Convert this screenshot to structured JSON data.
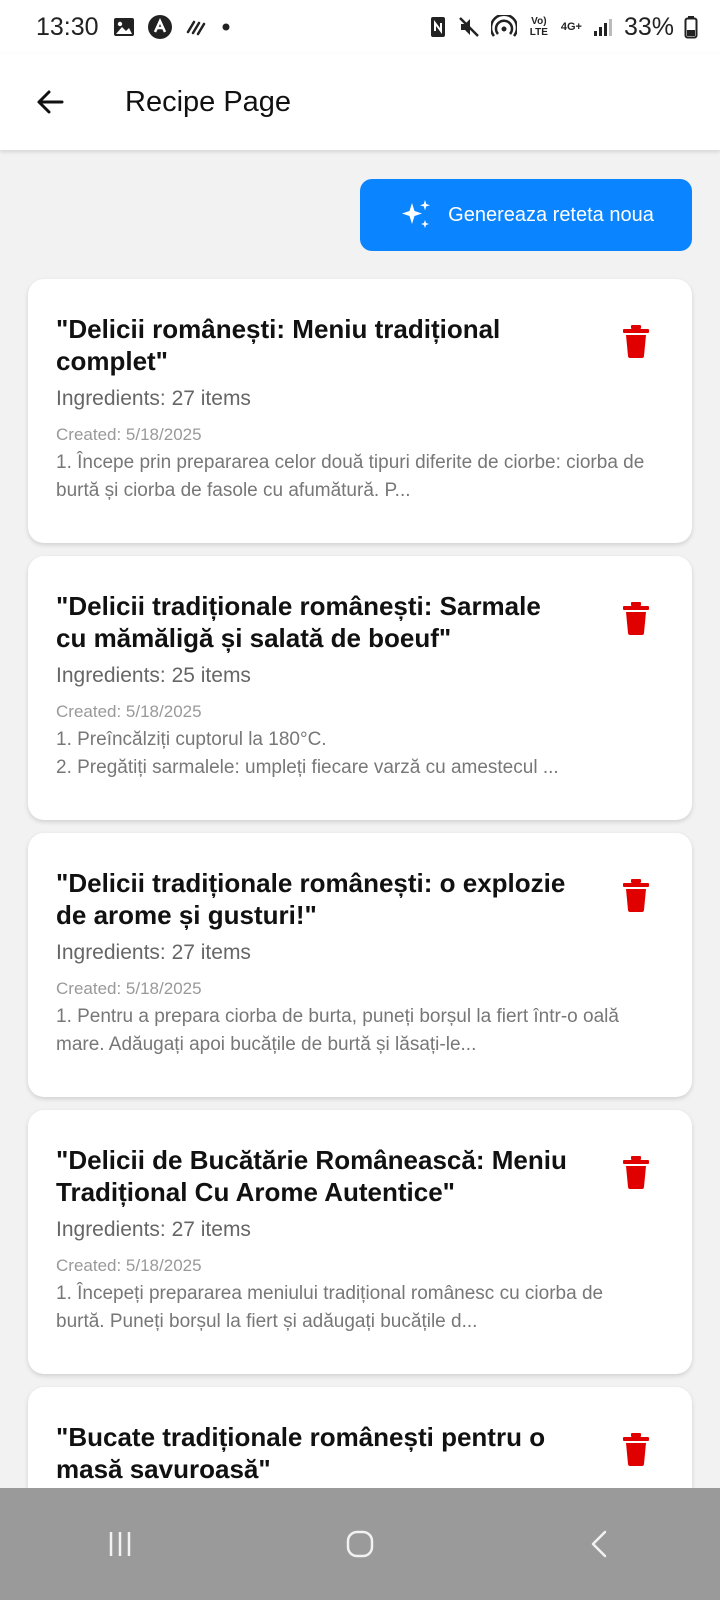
{
  "status_bar": {
    "time": "13:30",
    "battery": "33%",
    "left_icons": [
      "gallery-icon",
      "app-icon",
      "signal-wave-icon",
      "dot-icon"
    ],
    "right_icons": [
      "nfc-icon",
      "mute-icon",
      "hotspot-icon",
      "volte-icon",
      "4g-icon",
      "cell-signal-icon",
      "battery-icon"
    ],
    "volte_label": "Vo) LTE",
    "network_label": "4G+"
  },
  "app_bar": {
    "title": "Recipe Page",
    "back_icon": "arrow-left-icon"
  },
  "generate_button": {
    "label": "Genereaza reteta noua",
    "icon": "sparkles-icon",
    "color": "#0a84ff"
  },
  "recipes": [
    {
      "title": "\"Delicii românești: Meniu tradițional complet\"",
      "ingredients": "Ingredients: 27 items",
      "created": "Created: 5/18/2025",
      "description": "1. Începe prin prepararea celor două tipuri diferite de ciorbe: ciorba de burtă și ciorba de fasole cu afumătură. P..."
    },
    {
      "title": "\"Delicii tradiționale românești: Sarmale cu mămăligă și salată de boeuf\"",
      "ingredients": "Ingredients: 25 items",
      "created": "Created: 5/18/2025",
      "description": "1. Preîncălziți cuptorul la 180°C.\n2. Pregătiți sarmalele: umpleți fiecare varză cu amestecul ..."
    },
    {
      "title": "\"Delicii tradiționale românești: o explozie de arome și gusturi!\"",
      "ingredients": "Ingredients: 27 items",
      "created": "Created: 5/18/2025",
      "description": "1. Pentru a prepara ciorba de burta, puneți borșul la fiert într-o oală mare. Adăugați apoi bucățile de burtă și lăsați-le..."
    },
    {
      "title": "\"Delicii de Bucătărie Românească: Meniu Tradițional Cu Arome Autentice\"",
      "ingredients": "Ingredients: 27 items",
      "created": "Created: 5/18/2025",
      "description": "1. Începeți prepararea meniului tradițional românesc cu ciorba de burtă. Puneți borșul la fiert și adăugați bucățile d..."
    },
    {
      "title": "\"Bucate tradiționale românești pentru o masă savuroasă\"",
      "ingredients": "",
      "created": "",
      "description": ""
    }
  ],
  "delete_icon_color": "#e00000",
  "nav_bar": {
    "items": [
      "recent-apps-icon",
      "home-icon",
      "back-icon"
    ]
  }
}
